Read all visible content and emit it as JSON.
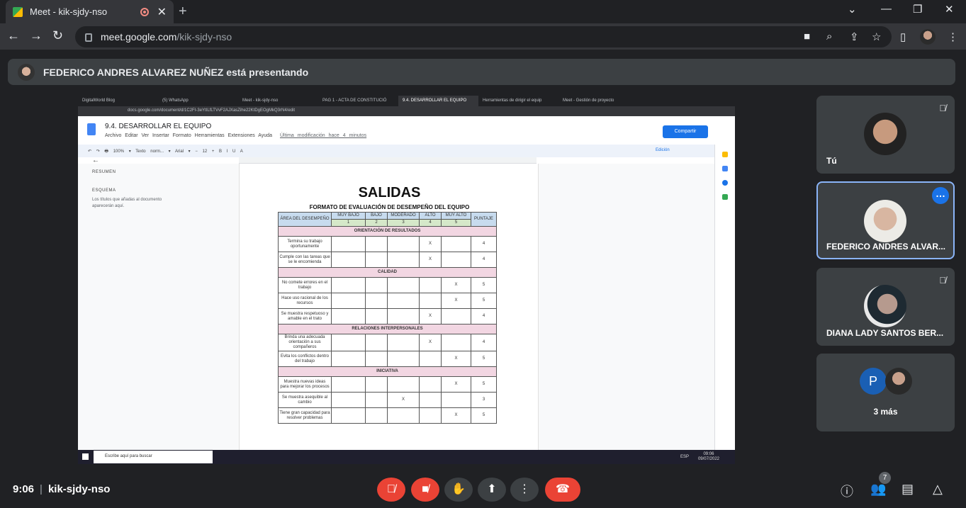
{
  "browser": {
    "tab_title": "Meet - kik-sjdy-nso",
    "url_host": "meet.google.com",
    "url_path": "/kik-sjdy-nso"
  },
  "presenting": {
    "text": "FEDERICO ANDRES ALVAREZ NUÑEZ está presentando"
  },
  "shared_screen": {
    "tabs": [
      "DigitalWorld Blog",
      "(5) WhatsApp",
      "Meet - kik-sjdy-nso",
      "PAG 1 - ACTA DE CONSTITUCIÓ",
      "9.4. DESARROLLAR EL EQUIPO",
      "Herramientas de dirigir el equip",
      "Meet - Gestión de proyecto"
    ],
    "url": "docs.google.com/document/d/1C2FI-3eYtILfLTVvF2AJXasZihe22KtDgEOgMkQ3rN4/edit",
    "doc_title": "9.4. DESARROLLAR EL EQUIPO",
    "menu": "Archivo Editar Ver Insertar Formato Herramientas Extensiones Ayuda",
    "last_modified": "Última modificación hace 4 minutos",
    "share": "Compartir",
    "toolbar": "↶ ↷ 🖶 100% ▾ Texto norm... ▾ Arial ▾ − 12 + B I U A",
    "mode": "Edición",
    "outline_summary": "RESUMEN",
    "outline_scheme": "ESQUEMA",
    "outline_note": "Los títulos que añadas al documento aparecerán aquí.",
    "heading": "SALIDAS",
    "subtitle": "FORMATO DE EVALUACIÓN DE DESEMPEÑO DEL EQUIPO",
    "table": {
      "area_header": "ÁREA DEL DESEMPEÑO",
      "levels": [
        "MUY BAJO",
        "BAJO",
        "MODERADO",
        "ALTO",
        "MUY ALTO"
      ],
      "numbers": [
        "1",
        "2",
        "3",
        "4",
        "5"
      ],
      "score_header": "PUNTAJE",
      "sections": [
        {
          "title": "ORIENTACIÓN DE RESULTADOS",
          "rows": [
            {
              "criterion": "Termina su trabajo oportunamente",
              "mark": 4,
              "score": "4"
            },
            {
              "criterion": "Cumple con las tareas que se le encomienda",
              "mark": 4,
              "score": "4"
            }
          ]
        },
        {
          "title": "CALIDAD",
          "rows": [
            {
              "criterion": "No comete errores en el trabajo",
              "mark": 5,
              "score": "5"
            },
            {
              "criterion": "Hace uso racional de los recursos",
              "mark": 5,
              "score": "5"
            },
            {
              "criterion": "Se muestra respetuoso y amable en el trato",
              "mark": 4,
              "score": "4"
            }
          ]
        },
        {
          "title": "RELACIONES INTERPERSONALES",
          "rows": [
            {
              "criterion": "Brinda una adecuada orientación a sus compañeros",
              "mark": 4,
              "score": "4"
            },
            {
              "criterion": "Evita los conflictos dentro del trabajo",
              "mark": 5,
              "score": "5"
            }
          ]
        },
        {
          "title": "INICIATIVA",
          "rows": [
            {
              "criterion": "Muestra nuevas ideas para mejorar los procesos",
              "mark": 5,
              "score": "5"
            },
            {
              "criterion": "Se muestra asequible al cambio",
              "mark": 3,
              "score": "3"
            },
            {
              "criterion": "Tiene gran capacidad para resolver problemas",
              "mark": 5,
              "score": "5"
            }
          ]
        }
      ]
    },
    "taskbar_search": "Escribe aquí para buscar",
    "taskbar_time": "09:06",
    "taskbar_date": "09/07/2022",
    "taskbar_lang": "ESP"
  },
  "participants": [
    {
      "name": "Tú",
      "muted": true
    },
    {
      "name": "FEDERICO ANDRES ALVAR...",
      "active": true
    },
    {
      "name": "DIANA LADY SANTOS BER...",
      "muted": true
    }
  ],
  "more_participants": {
    "initial": "P",
    "label": "3 más"
  },
  "bottom": {
    "time": "9:06",
    "meeting_code": "kik-sjdy-nso",
    "people_count": "7"
  },
  "colors": {
    "end_call": "#ea4335",
    "accent": "#1a73e8",
    "active_border": "#8ab4f8"
  }
}
